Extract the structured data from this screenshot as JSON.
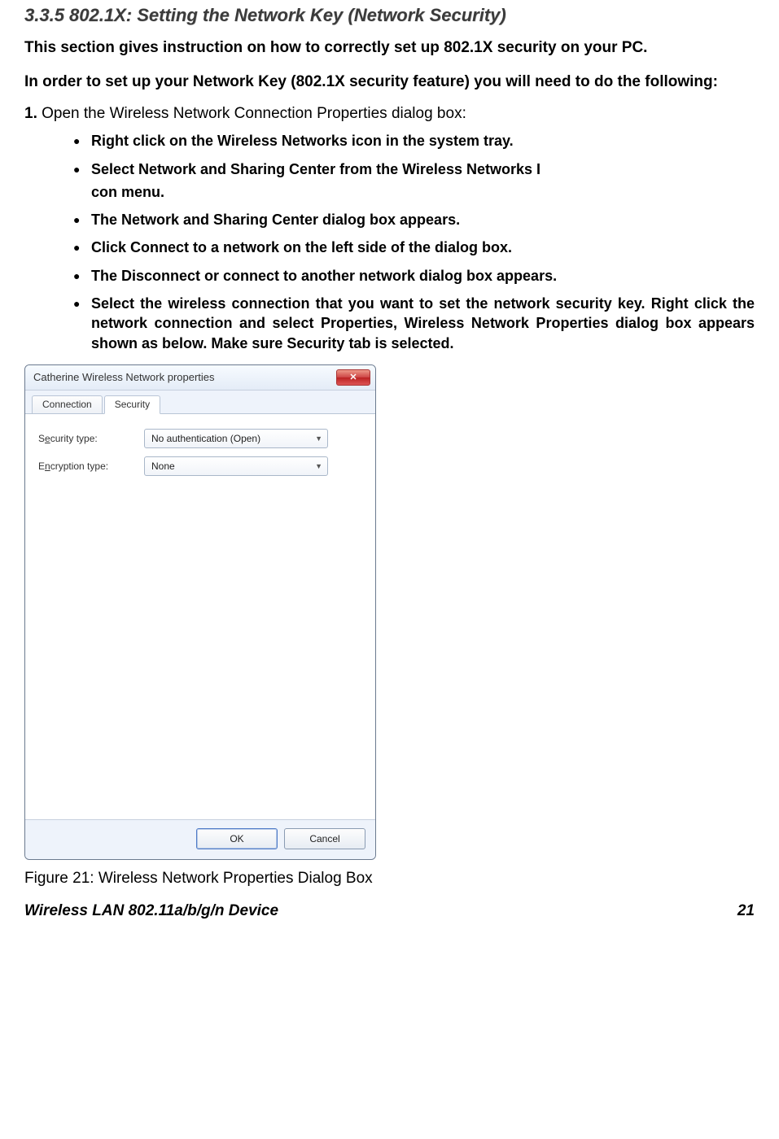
{
  "heading": "3.3.5  802.1X:  Setting the Network Key (Network Security)",
  "intro": "This section gives instruction on how to correctly set up 802.1X security on your PC.",
  "intro2": "In order to set up your Network Key (802.1X security feature) you will need to do the following:",
  "step_num": "1.",
  "step_text": "Open the Wireless Network Connection Properties dialog box:",
  "bullets": [
    "Right click on the Wireless Networks icon in the system tray.",
    "Select Network and Sharing Center from the Wireless Networks I",
    "con menu.",
    "The Network and Sharing Center dialog box appears.",
    "Click Connect to a network on the left side of the dialog box.",
    "The Disconnect or connect to another network dialog box appears.",
    "Select the wireless connection that you want to set the network security key. Right click the network connection and select Properties, Wireless Network Properties dialog box appears shown as below.  Make sure Security tab is selected."
  ],
  "dialog": {
    "title": "Catherine Wireless Network properties",
    "close_glyph": "✕",
    "tabs": {
      "connection": "Connection",
      "security": "Security"
    },
    "labels": {
      "security_type_pre": "S",
      "security_type_ul": "e",
      "security_type_post": "curity type:",
      "encryption_type_pre": "E",
      "encryption_type_ul": "n",
      "encryption_type_post": "cryption type:"
    },
    "values": {
      "security_type": "No authentication (Open)",
      "encryption_type": "None"
    },
    "buttons": {
      "ok": "OK",
      "cancel": "Cancel"
    }
  },
  "figure_caption": "Figure 21: Wireless Network Properties Dialog Box",
  "footer": {
    "left": "Wireless LAN 802.11a/b/g/n Device",
    "right": "21"
  }
}
